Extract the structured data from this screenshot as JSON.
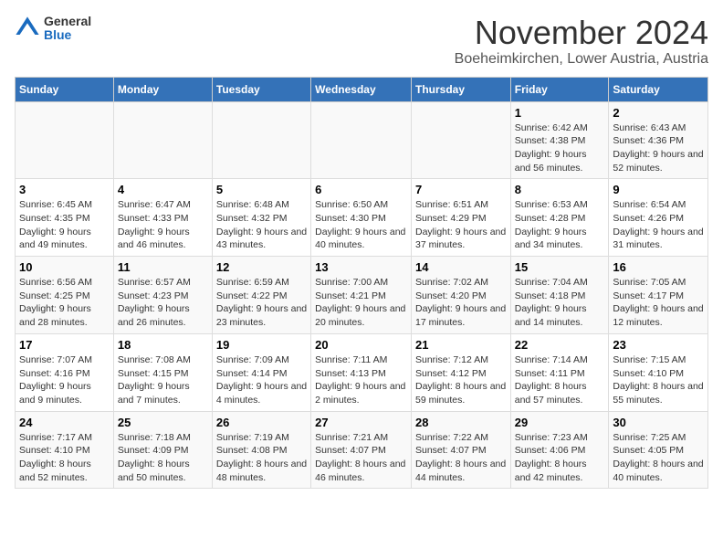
{
  "logo": {
    "general": "General",
    "blue": "Blue"
  },
  "title": "November 2024",
  "subtitle": "Boeheimkirchen, Lower Austria, Austria",
  "days_of_week": [
    "Sunday",
    "Monday",
    "Tuesday",
    "Wednesday",
    "Thursday",
    "Friday",
    "Saturday"
  ],
  "weeks": [
    [
      {
        "day": "",
        "info": ""
      },
      {
        "day": "",
        "info": ""
      },
      {
        "day": "",
        "info": ""
      },
      {
        "day": "",
        "info": ""
      },
      {
        "day": "",
        "info": ""
      },
      {
        "day": "1",
        "info": "Sunrise: 6:42 AM\nSunset: 4:38 PM\nDaylight: 9 hours and 56 minutes."
      },
      {
        "day": "2",
        "info": "Sunrise: 6:43 AM\nSunset: 4:36 PM\nDaylight: 9 hours and 52 minutes."
      }
    ],
    [
      {
        "day": "3",
        "info": "Sunrise: 6:45 AM\nSunset: 4:35 PM\nDaylight: 9 hours and 49 minutes."
      },
      {
        "day": "4",
        "info": "Sunrise: 6:47 AM\nSunset: 4:33 PM\nDaylight: 9 hours and 46 minutes."
      },
      {
        "day": "5",
        "info": "Sunrise: 6:48 AM\nSunset: 4:32 PM\nDaylight: 9 hours and 43 minutes."
      },
      {
        "day": "6",
        "info": "Sunrise: 6:50 AM\nSunset: 4:30 PM\nDaylight: 9 hours and 40 minutes."
      },
      {
        "day": "7",
        "info": "Sunrise: 6:51 AM\nSunset: 4:29 PM\nDaylight: 9 hours and 37 minutes."
      },
      {
        "day": "8",
        "info": "Sunrise: 6:53 AM\nSunset: 4:28 PM\nDaylight: 9 hours and 34 minutes."
      },
      {
        "day": "9",
        "info": "Sunrise: 6:54 AM\nSunset: 4:26 PM\nDaylight: 9 hours and 31 minutes."
      }
    ],
    [
      {
        "day": "10",
        "info": "Sunrise: 6:56 AM\nSunset: 4:25 PM\nDaylight: 9 hours and 28 minutes."
      },
      {
        "day": "11",
        "info": "Sunrise: 6:57 AM\nSunset: 4:23 PM\nDaylight: 9 hours and 26 minutes."
      },
      {
        "day": "12",
        "info": "Sunrise: 6:59 AM\nSunset: 4:22 PM\nDaylight: 9 hours and 23 minutes."
      },
      {
        "day": "13",
        "info": "Sunrise: 7:00 AM\nSunset: 4:21 PM\nDaylight: 9 hours and 20 minutes."
      },
      {
        "day": "14",
        "info": "Sunrise: 7:02 AM\nSunset: 4:20 PM\nDaylight: 9 hours and 17 minutes."
      },
      {
        "day": "15",
        "info": "Sunrise: 7:04 AM\nSunset: 4:18 PM\nDaylight: 9 hours and 14 minutes."
      },
      {
        "day": "16",
        "info": "Sunrise: 7:05 AM\nSunset: 4:17 PM\nDaylight: 9 hours and 12 minutes."
      }
    ],
    [
      {
        "day": "17",
        "info": "Sunrise: 7:07 AM\nSunset: 4:16 PM\nDaylight: 9 hours and 9 minutes."
      },
      {
        "day": "18",
        "info": "Sunrise: 7:08 AM\nSunset: 4:15 PM\nDaylight: 9 hours and 7 minutes."
      },
      {
        "day": "19",
        "info": "Sunrise: 7:09 AM\nSunset: 4:14 PM\nDaylight: 9 hours and 4 minutes."
      },
      {
        "day": "20",
        "info": "Sunrise: 7:11 AM\nSunset: 4:13 PM\nDaylight: 9 hours and 2 minutes."
      },
      {
        "day": "21",
        "info": "Sunrise: 7:12 AM\nSunset: 4:12 PM\nDaylight: 8 hours and 59 minutes."
      },
      {
        "day": "22",
        "info": "Sunrise: 7:14 AM\nSunset: 4:11 PM\nDaylight: 8 hours and 57 minutes."
      },
      {
        "day": "23",
        "info": "Sunrise: 7:15 AM\nSunset: 4:10 PM\nDaylight: 8 hours and 55 minutes."
      }
    ],
    [
      {
        "day": "24",
        "info": "Sunrise: 7:17 AM\nSunset: 4:10 PM\nDaylight: 8 hours and 52 minutes."
      },
      {
        "day": "25",
        "info": "Sunrise: 7:18 AM\nSunset: 4:09 PM\nDaylight: 8 hours and 50 minutes."
      },
      {
        "day": "26",
        "info": "Sunrise: 7:19 AM\nSunset: 4:08 PM\nDaylight: 8 hours and 48 minutes."
      },
      {
        "day": "27",
        "info": "Sunrise: 7:21 AM\nSunset: 4:07 PM\nDaylight: 8 hours and 46 minutes."
      },
      {
        "day": "28",
        "info": "Sunrise: 7:22 AM\nSunset: 4:07 PM\nDaylight: 8 hours and 44 minutes."
      },
      {
        "day": "29",
        "info": "Sunrise: 7:23 AM\nSunset: 4:06 PM\nDaylight: 8 hours and 42 minutes."
      },
      {
        "day": "30",
        "info": "Sunrise: 7:25 AM\nSunset: 4:05 PM\nDaylight: 8 hours and 40 minutes."
      }
    ]
  ]
}
